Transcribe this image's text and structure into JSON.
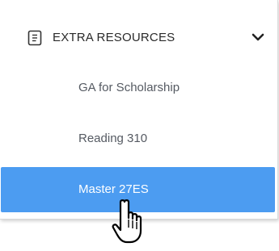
{
  "section": {
    "title": "EXTRA RESOURCES",
    "icon": "clipboard-list-icon",
    "expanded_indicator": "chevron-down-icon"
  },
  "items": [
    {
      "label": "GA for Scholarship",
      "selected": false
    },
    {
      "label": "Reading 310",
      "selected": false
    },
    {
      "label": "Master 27ES",
      "selected": true
    }
  ],
  "colors": {
    "selected_bg": "#4c9cf1",
    "item_text": "#555a62",
    "header_text": "#2a2a2a"
  },
  "cursor": "hand-pointer-icon"
}
